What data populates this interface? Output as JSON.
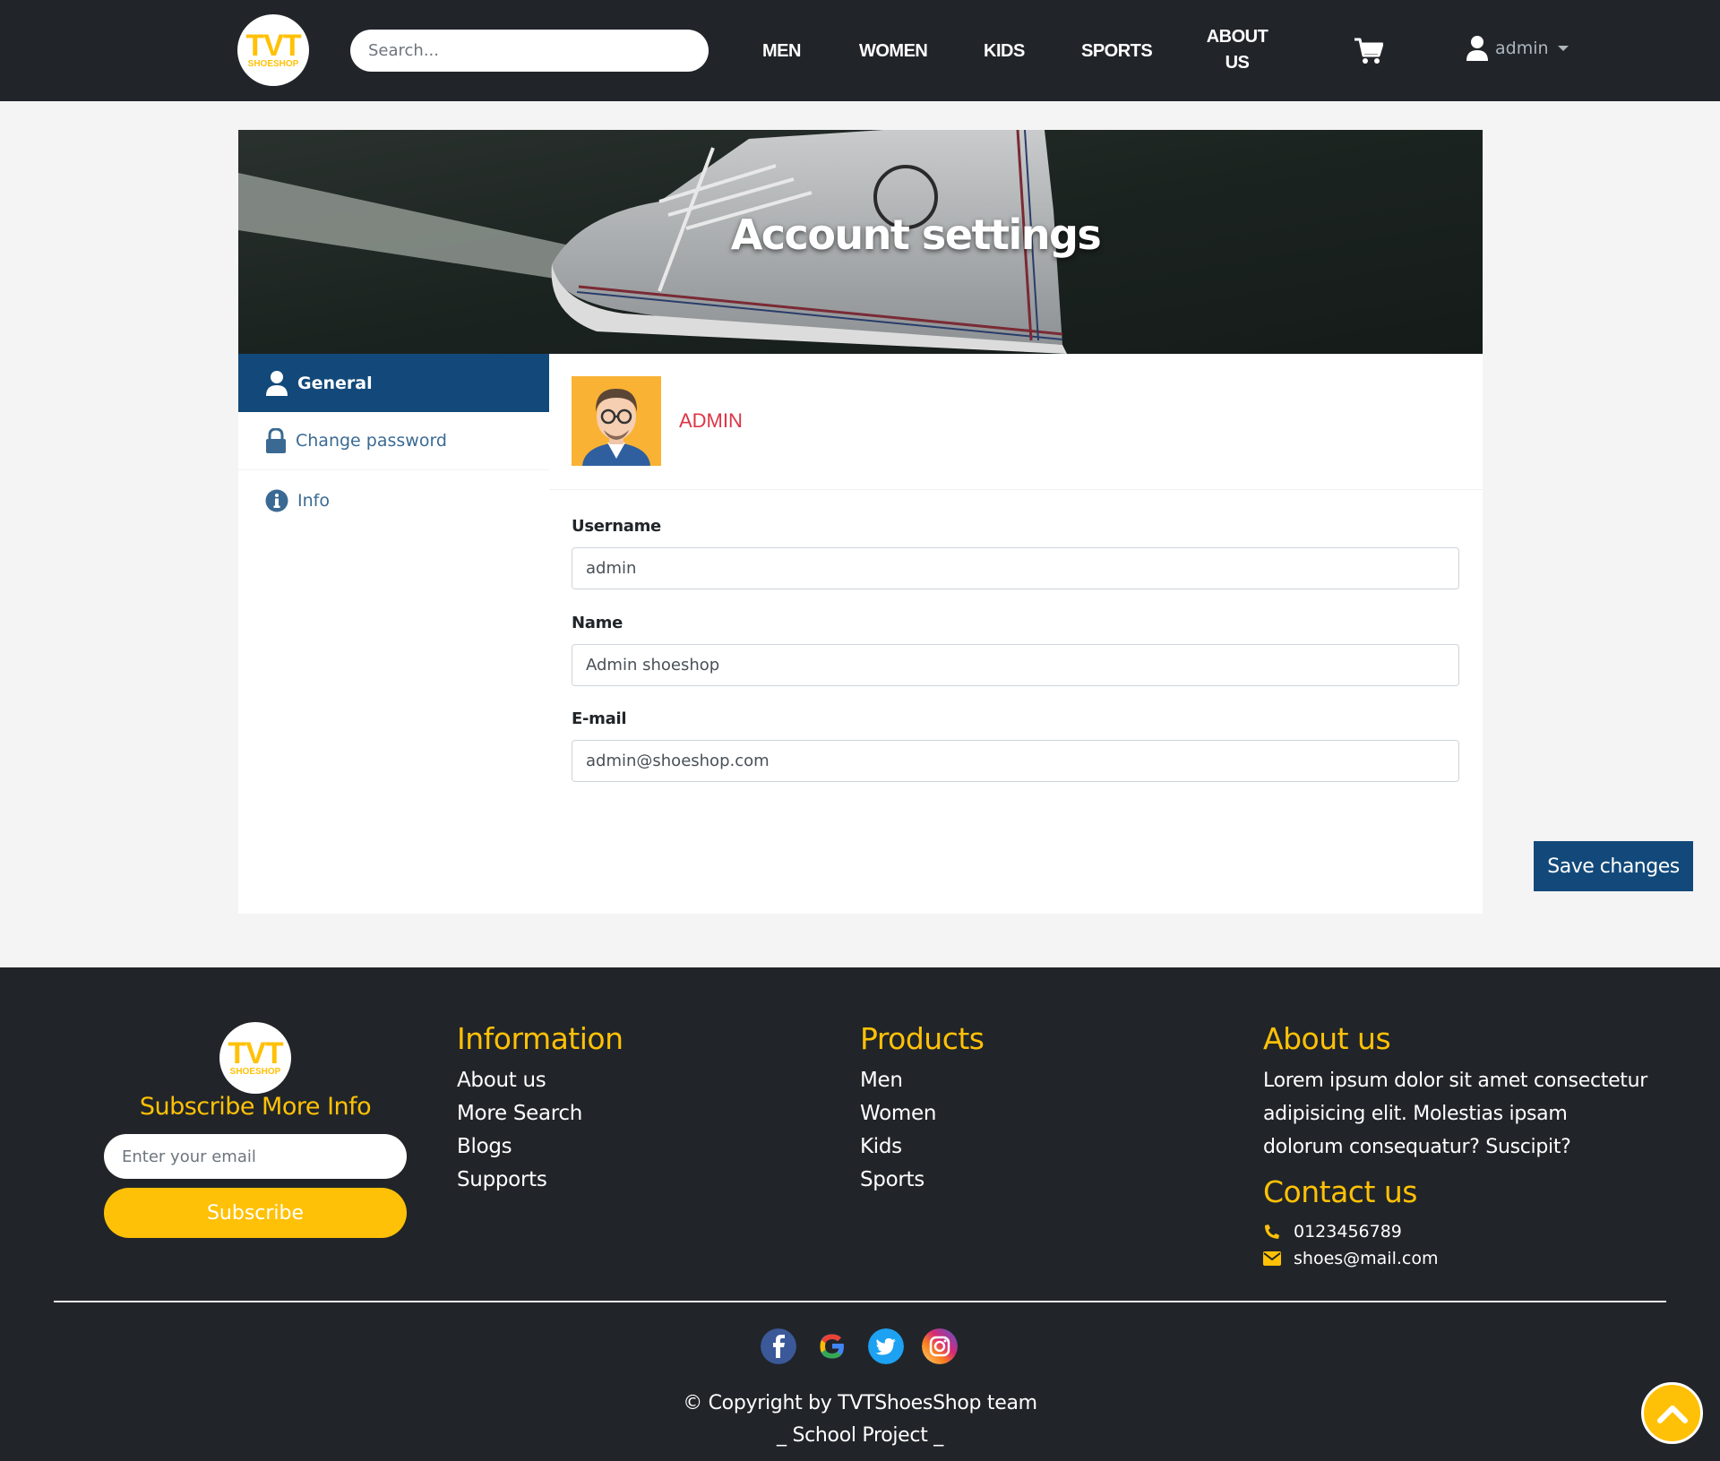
{
  "brand": {
    "logo_main": "TVT",
    "logo_sub": "SHOESHOP"
  },
  "nav": {
    "search_placeholder": "Search...",
    "links": [
      "MEN",
      "WOMEN",
      "KIDS",
      "SPORTS"
    ],
    "about_line1": "ABOUT",
    "about_line2": "US",
    "user": "admin"
  },
  "banner": {
    "title": "Account settings"
  },
  "sidebar": {
    "items": [
      {
        "label": "General",
        "icon": "user-icon",
        "active": true
      },
      {
        "label": "Change password",
        "icon": "lock-icon",
        "active": false
      },
      {
        "label": "Info",
        "icon": "info-icon",
        "active": false
      }
    ]
  },
  "profile": {
    "name": "ADMIN"
  },
  "form": {
    "username_label": "Username",
    "username_value": "admin",
    "name_label": "Name",
    "name_value": "Admin shoeshop",
    "email_label": "E-mail",
    "email_value": "admin@shoeshop.com",
    "save_label": "Save changes"
  },
  "footer": {
    "subscribe_title": "Subscribe More Info",
    "email_placeholder": "Enter your email",
    "subscribe_label": "Subscribe",
    "information": {
      "title": "Information",
      "links": [
        "About us",
        "More Search",
        "Blogs",
        "Supports"
      ]
    },
    "products": {
      "title": "Products",
      "links": [
        "Men",
        "Women",
        "Kids",
        "Sports"
      ]
    },
    "about": {
      "title": "About us",
      "text": "Lorem ipsum dolor sit amet consectetur adipisicing elit. Molestias ipsam dolorum consequatur? Suscipit?"
    },
    "contact": {
      "title": "Contact us",
      "phone": "0123456789",
      "email": "shoes@mail.com"
    },
    "social": [
      "facebook-icon",
      "google-icon",
      "twitter-icon",
      "instagram-icon"
    ],
    "copyright": "© Copyright by TVTShoesShop team",
    "project": "_ School Project _"
  },
  "colors": {
    "accent": "#ffc107",
    "primary": "#12497a",
    "dark": "#212529",
    "danger": "#dc3545"
  }
}
